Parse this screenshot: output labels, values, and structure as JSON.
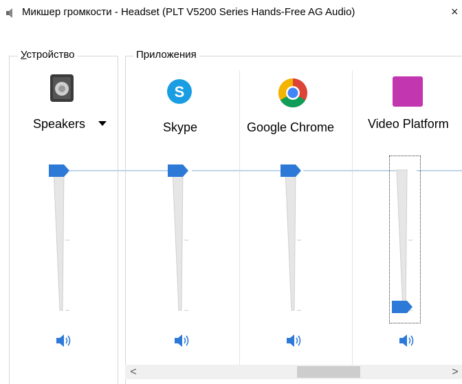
{
  "window": {
    "title": "Микшер громкости - Headset (PLT V5200 Series Hands-Free AG Audio)",
    "close_glyph": "×",
    "icon": "speaker-icon"
  },
  "device_group": {
    "label_accel": "У",
    "label_rest": "стройство",
    "device_name": "Speakers",
    "dropdown_icon": "chevron-down-icon",
    "volume_percent": 100,
    "muted": false
  },
  "apps_group": {
    "label": "Приложения",
    "apps": [
      {
        "name": "Skype",
        "icon": "skype-icon",
        "volume_percent": 100,
        "muted": false
      },
      {
        "name": "Google Chrome",
        "icon": "chrome-icon",
        "volume_percent": 100,
        "muted": false
      },
      {
        "name": "Video Platform",
        "icon": "video-platform-icon",
        "volume_percent": 0,
        "muted": false,
        "focused": true
      }
    ]
  },
  "scrollbar": {
    "left_glyph": "<",
    "right_glyph": ">"
  },
  "colors": {
    "accent": "#2d79d8",
    "link_line": "#bfd4ea",
    "video_platform": "#c236b0"
  }
}
